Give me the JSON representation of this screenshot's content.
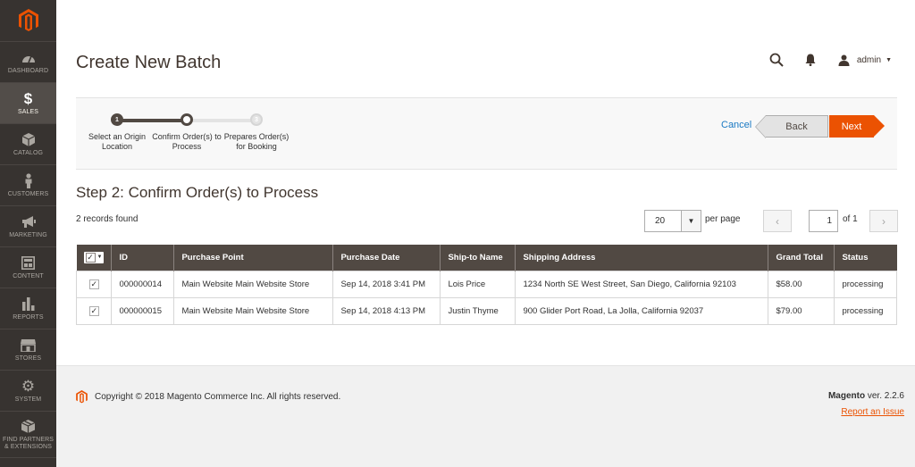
{
  "sidebar": {
    "items": [
      {
        "label": "DASHBOARD",
        "icon": "dashboard-icon"
      },
      {
        "label": "SALES",
        "icon": "dollar-icon"
      },
      {
        "label": "CATALOG",
        "icon": "cube-icon"
      },
      {
        "label": "CUSTOMERS",
        "icon": "person-icon"
      },
      {
        "label": "MARKETING",
        "icon": "megaphone-icon"
      },
      {
        "label": "CONTENT",
        "icon": "layout-icon"
      },
      {
        "label": "REPORTS",
        "icon": "bars-icon"
      },
      {
        "label": "STORES",
        "icon": "storefront-icon"
      },
      {
        "label": "SYSTEM",
        "icon": "gear-icon"
      },
      {
        "label": "FIND PARTNERS & EXTENSIONS",
        "icon": "box-icon"
      }
    ]
  },
  "header": {
    "title": "Create New Batch",
    "user": "admin"
  },
  "wizard": {
    "steps": [
      {
        "number": "1",
        "label": "Select an Origin Location"
      },
      {
        "number": "2",
        "label": "Confirm Order(s) to Process"
      },
      {
        "number": "3",
        "label": "Prepares Order(s) for Booking"
      }
    ],
    "cancel": "Cancel",
    "back": "Back",
    "next": "Next"
  },
  "step_heading": "Step 2: Confirm Order(s) to Process",
  "records_found": "2 records found",
  "pager": {
    "per_page_value": "20",
    "per_page_label": "per page",
    "current_page": "1",
    "of_label": "of 1"
  },
  "grid": {
    "columns": [
      "ID",
      "Purchase Point",
      "Purchase Date",
      "Ship-to Name",
      "Shipping Address",
      "Grand Total",
      "Status"
    ],
    "rows": [
      {
        "id": "000000014",
        "purchase_point": "Main Website Main Website Store",
        "purchase_date": "Sep 14, 2018 3:41 PM",
        "ship_to": "Lois Price",
        "address": "1234 North SE West Street, San Diego, California 92103",
        "total": "$58.00",
        "status": "processing"
      },
      {
        "id": "000000015",
        "purchase_point": "Main Website Main Website Store",
        "purchase_date": "Sep 14, 2018 4:13 PM",
        "ship_to": "Justin Thyme",
        "address": "900 Glider Port Road, La Jolla, California 92037",
        "total": "$79.00",
        "status": "processing"
      }
    ]
  },
  "footer": {
    "copyright": "Copyright © 2018 Magento Commerce Inc. All rights reserved.",
    "brand": "Magento",
    "version": " ver. 2.2.6",
    "report": "Report an Issue"
  },
  "colors": {
    "accent": "#eb5202",
    "sidebar": "#373330",
    "table_header": "#514943",
    "link": "#1979c3"
  }
}
